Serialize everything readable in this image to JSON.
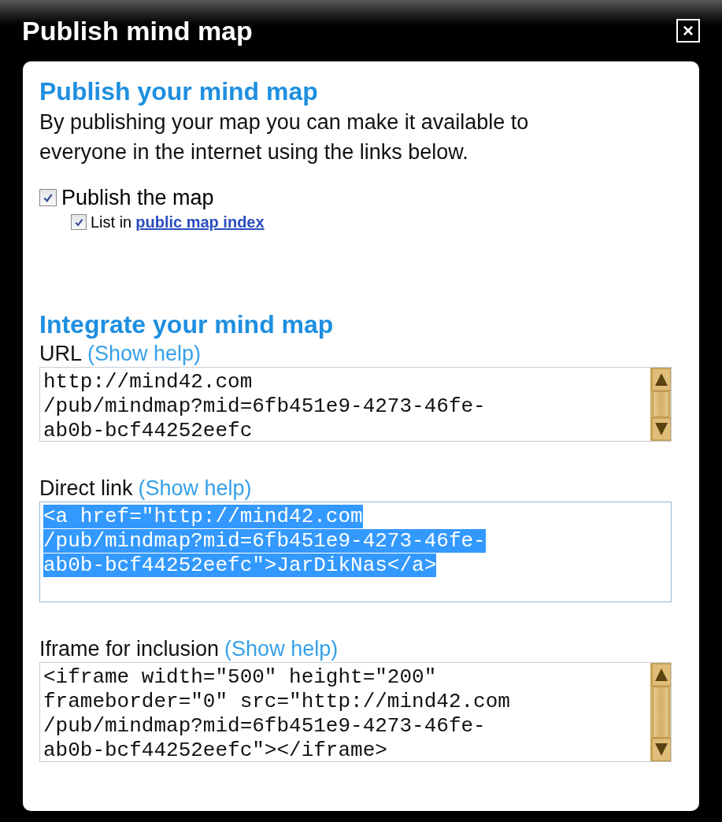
{
  "window": {
    "title": "Publish mind map",
    "close": "×"
  },
  "publish": {
    "heading": "Publish your mind map",
    "description": "By publishing your map you can make it available to everyone in the internet using the links below."
  },
  "options": [
    {
      "label": "Publish the map",
      "checked": true,
      "children": [
        {
          "label": "List in",
          "link": "public map index",
          "checked": true
        }
      ]
    }
  ],
  "integrate": {
    "heading": "Integrate your mind map",
    "fields": [
      {
        "label": "URL",
        "help": "(Show help)",
        "selected": false,
        "scrollbar": true,
        "lines": [
          "http://mind42.com",
          "/pub/mindmap?mid=6fb451e9-4273-46fe-",
          "ab0b-bcf44252eefc"
        ]
      },
      {
        "label": "Direct link",
        "help": "(Show help)",
        "selected": true,
        "scrollbar": false,
        "lines": [
          "<a href=\"http://mind42.com",
          "/pub/mindmap?mid=6fb451e9-4273-46fe-",
          "ab0b-bcf44252eefc\">JarDikNas</a>"
        ]
      },
      {
        "label": "Iframe for inclusion",
        "help": "(Show help)",
        "selected": false,
        "scrollbar": true,
        "lines": [
          "<iframe width=\"500\" height=\"200\"",
          "frameborder=\"0\" src=\"http://mind42.com",
          "/pub/mindmap?mid=6fb451e9-4273-46fe-",
          "ab0b-bcf44252eefc\"></iframe>"
        ]
      }
    ]
  }
}
